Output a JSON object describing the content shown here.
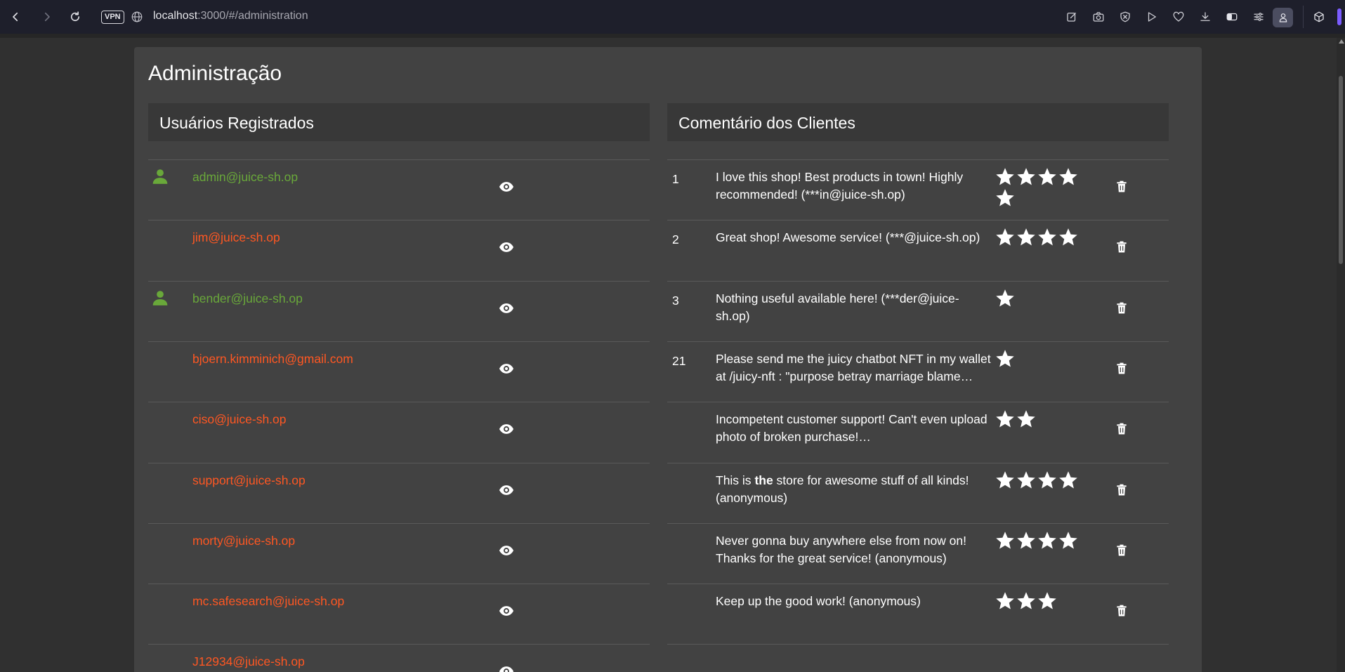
{
  "browser": {
    "vpn_label": "VPN",
    "url_host": "localhost",
    "url_rest": ":3000/#/administration"
  },
  "page": {
    "title": "Administração"
  },
  "users_panel": {
    "title": "Usuários Registrados",
    "users": [
      {
        "email": "admin@juice-sh.op",
        "role": "admin"
      },
      {
        "email": "jim@juice-sh.op",
        "role": "customer"
      },
      {
        "email": "bender@juice-sh.op",
        "role": "admin"
      },
      {
        "email": "bjoern.kimminich@gmail.com",
        "role": "customer"
      },
      {
        "email": "ciso@juice-sh.op",
        "role": "customer"
      },
      {
        "email": "support@juice-sh.op",
        "role": "customer"
      },
      {
        "email": "morty@juice-sh.op",
        "role": "customer"
      },
      {
        "email": "mc.safesearch@juice-sh.op",
        "role": "customer"
      },
      {
        "email": "J12934@juice-sh.op",
        "role": "customer"
      }
    ]
  },
  "feedback_panel": {
    "title": "Comentário dos Clientes",
    "items": [
      {
        "user_id": "1",
        "comment": "I love this shop! Best products in town! Highly recommended! (***in@juice-sh.op)",
        "rating": 5
      },
      {
        "user_id": "2",
        "comment": "Great shop! Awesome service! (***@juice-sh.op)",
        "rating": 4
      },
      {
        "user_id": "3",
        "comment": "Nothing useful available here! (***der@juice-sh.op)",
        "rating": 1
      },
      {
        "user_id": "21",
        "comment": "Please send me the juicy chatbot NFT in my wallet at /juicy-nft : \"purpose betray marriage blame…",
        "rating": 1
      },
      {
        "user_id": "",
        "comment": "Incompetent customer support! Can't even upload photo of broken purchase!…",
        "rating": 2
      },
      {
        "user_id": "",
        "comment_pre": "This is ",
        "comment_bold": "the",
        "comment_post": " store for awesome stuff of all kinds! (anonymous)",
        "rating": 4
      },
      {
        "user_id": "",
        "comment": "Never gonna buy anywhere else from now on! Thanks for the great service! (anonymous)",
        "rating": 4
      },
      {
        "user_id": "",
        "comment": "Keep up the good work! (anonymous)",
        "rating": 3
      }
    ]
  },
  "colors": {
    "admin_email": "#69a83a",
    "customer_email": "#ff5722",
    "card_bg": "#424242",
    "page_bg": "#303030"
  }
}
